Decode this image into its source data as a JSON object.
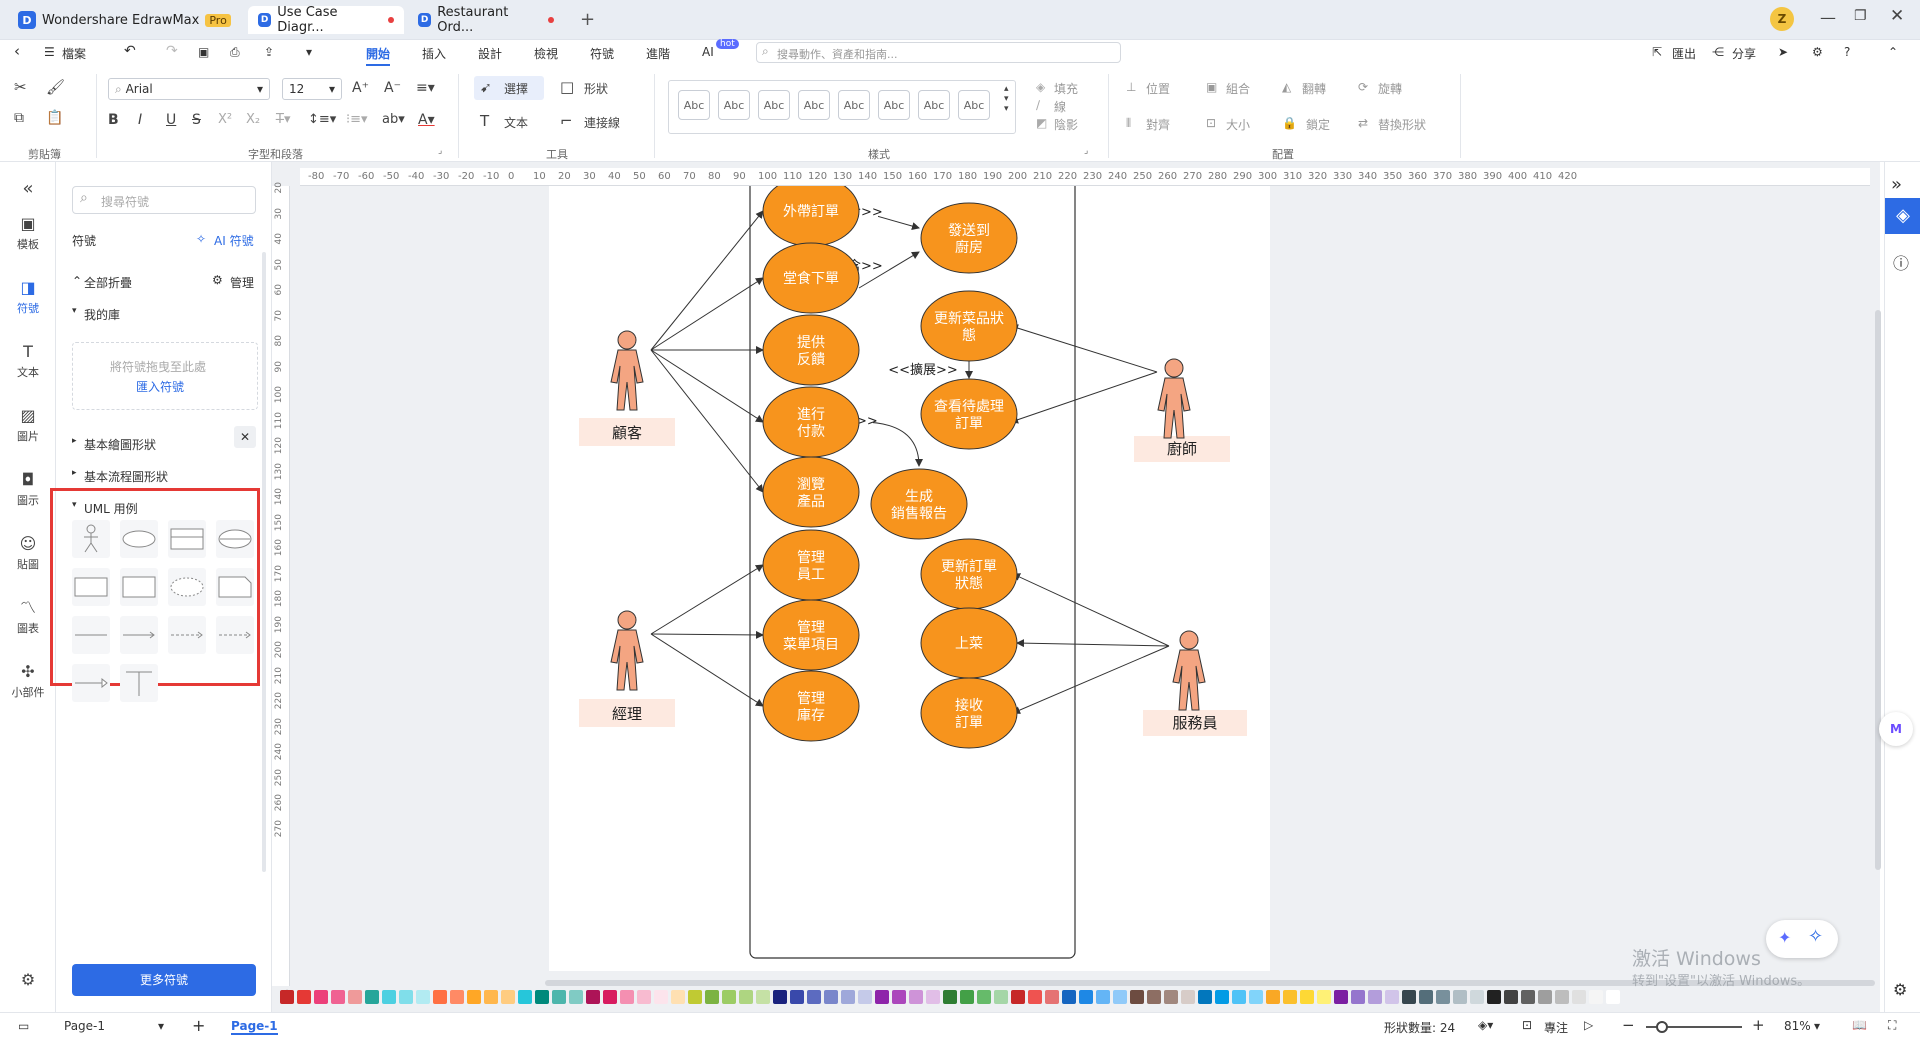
{
  "titlebar": {
    "app_name": "Wondershare EdrawMax",
    "pro_badge": "Pro",
    "tabs": [
      {
        "label": "Use Case Diagr...",
        "modified": true
      },
      {
        "label": "Restaurant Ord...",
        "modified": true
      }
    ],
    "user_initial": "Z"
  },
  "menubar": {
    "file": "檔案",
    "tabs": [
      "開始",
      "插入",
      "設計",
      "檢視",
      "符號",
      "進階"
    ],
    "ai_label": "AI",
    "ai_badge": "hot",
    "search_placeholder": "搜尋動作、資產和指南...",
    "export": "匯出",
    "share": "分享"
  },
  "ribbon": {
    "font_name": "Arial",
    "font_size": "12",
    "groups": [
      "剪貼簿",
      "字型和段落",
      "工具",
      "樣式",
      "配置"
    ],
    "select": "選擇",
    "shape": "形狀",
    "text": "文本",
    "connector": "連接線",
    "style_samples": [
      "Abc",
      "Abc",
      "Abc",
      "Abc",
      "Abc",
      "Abc",
      "Abc",
      "Abc"
    ],
    "fill": "填充",
    "line": "線",
    "shadow": "陰影",
    "position": "位置",
    "group": "組合",
    "flip": "翻轉",
    "rotate": "旋轉",
    "align": "對齊",
    "size": "大小",
    "lock": "鎖定",
    "replace_shape": "替換形狀"
  },
  "rail": {
    "items": [
      "模板",
      "符號",
      "文本",
      "圖片",
      "圖示",
      "貼圖",
      "圖表",
      "小部件"
    ]
  },
  "panel": {
    "search_placeholder": "搜尋符號",
    "title": "符號",
    "ai_symbols": "AI 符號",
    "collapse_all": "全部折疊",
    "manage": "管理",
    "my_library": "我的庫",
    "drop_hint": "將符號拖曳至此處",
    "import_symbols": "匯入符號",
    "basic_shapes": "基本繪圖形狀",
    "basic_flow": "基本流程圖形狀",
    "uml_usecase": "UML 用例",
    "more_symbols": "更多符號"
  },
  "ruler": {
    "h_ticks": [
      "-80",
      "-70",
      "-60",
      "-50",
      "-40",
      "-30",
      "-20",
      "-10",
      "0",
      "10",
      "20",
      "30",
      "40",
      "50",
      "60",
      "70",
      "80",
      "90",
      "100",
      "110",
      "120",
      "130",
      "140",
      "150",
      "160",
      "170",
      "180",
      "190",
      "200",
      "210",
      "220",
      "230",
      "240",
      "250",
      "260",
      "270",
      "280",
      "290",
      "300",
      "310",
      "320",
      "330",
      "340",
      "350",
      "360",
      "370",
      "380",
      "390",
      "400",
      "410",
      "420"
    ],
    "v_ticks": [
      "20",
      "30",
      "40",
      "50",
      "60",
      "70",
      "80",
      "90",
      "100",
      "110",
      "120",
      "130",
      "140",
      "150",
      "160",
      "170",
      "180",
      "190",
      "200",
      "210",
      "220",
      "230",
      "240",
      "250",
      "260",
      "270"
    ]
  },
  "diagram": {
    "actors": [
      "顧客",
      "經理",
      "廚師",
      "服務員"
    ],
    "usecases": [
      "外帶訂單",
      "堂食下單",
      "提供\n反饋",
      "進行\n付款",
      "瀏覽\n產品",
      "管理\n員工",
      "管理\n菜單項目",
      "管理\n庫存",
      "發送到\n廚房",
      "更新菜品狀\n態",
      "查看待處理\n訂單",
      "生成\n銷售報告",
      "更新訂單\n狀態",
      "上菜",
      "接收\n訂單"
    ],
    "relations": [
      "<<包含>>",
      "<<包含>>",
      "<<擴展>>",
      "<<包含>>"
    ]
  },
  "statusbar": {
    "page_tab": "Page-1",
    "active_page": "Page-1",
    "shape_count": "形狀數量: 24",
    "focus": "專注",
    "zoom": "81%"
  },
  "watermark": {
    "line1": "激活 Windows",
    "line2": "转到\"设置\"以激活 Windows。"
  },
  "colors": {
    "usecase_fill": "#f7941d",
    "actor_fill": "#f4a582",
    "actor_label_bg": "#fde9e0",
    "accent": "#2d6be4",
    "highlight": "#e53935"
  }
}
